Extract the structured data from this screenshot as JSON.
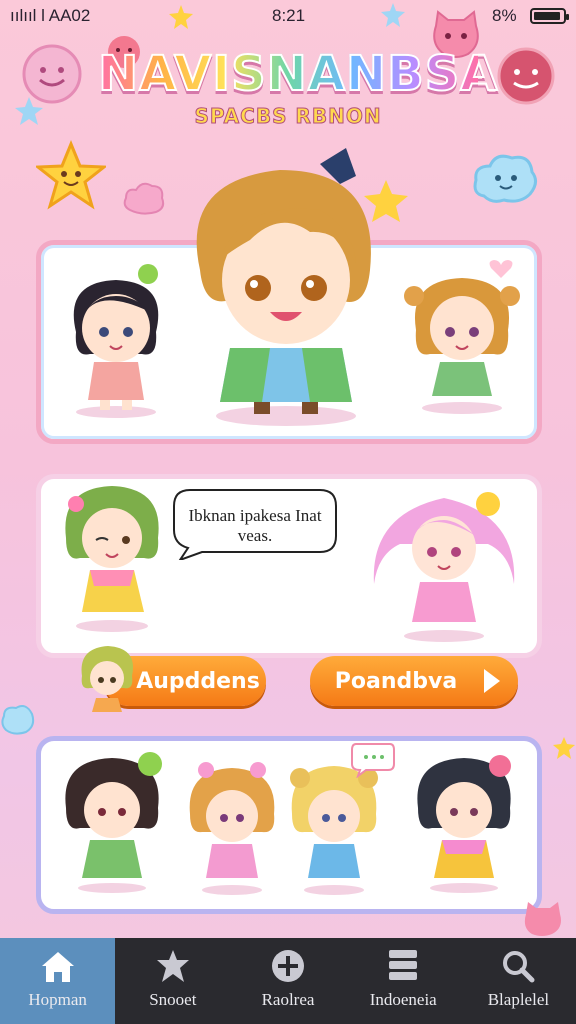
{
  "status_bar": {
    "signal": "ıılııl  l  AA02",
    "time": "8:21",
    "battery": "8%"
  },
  "title": {
    "main": "NAVISNANBSA",
    "sub": "SPACBS RBNON"
  },
  "speech_bubble": {
    "text": "Ibknan ipakesa Inat veas."
  },
  "buttons": {
    "left_label": "Aupddens",
    "right_label": "Poandbva"
  },
  "nav": {
    "items": [
      {
        "label": "Hopman",
        "icon": "home-icon",
        "active": true
      },
      {
        "label": "Snooet",
        "icon": "star-figure-icon",
        "active": false
      },
      {
        "label": "Raolrea",
        "icon": "plus-circle-icon",
        "active": false
      },
      {
        "label": "Indoeneia",
        "icon": "stack-icon",
        "active": false
      },
      {
        "label": "Blaplelel",
        "icon": "search-icon",
        "active": false
      }
    ]
  },
  "colors": {
    "background": "#fbc9d9",
    "accent_orange": "#f57a16",
    "nav_background": "#2a2a2f",
    "nav_active": "#5c8fbd"
  }
}
